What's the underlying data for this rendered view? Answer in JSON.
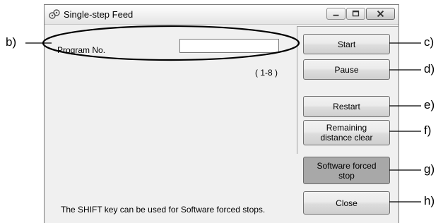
{
  "window": {
    "title": "Single-step Feed",
    "controls": {
      "minimize": "minimize-icon",
      "maximize": "maximize-icon",
      "close": "close-icon"
    }
  },
  "form": {
    "program_label": "Program No.",
    "program_value": "",
    "range_text": "( 1-8 )"
  },
  "buttons": {
    "start": "Start",
    "pause": "Pause",
    "restart": "Restart",
    "remaining_clear": "Remaining\ndistance clear",
    "software_stop": "Software forced\nstop",
    "close": "Close"
  },
  "hint_text": "The SHIFT key can be used for Software forced stops.",
  "callouts": {
    "b": "b)",
    "c": "c)",
    "d": "d)",
    "e": "e)",
    "f": "f)",
    "g": "g)",
    "h": "h)"
  },
  "colors": {
    "window_bg": "#f0f0f0",
    "button_gray": "#a8a8a8"
  }
}
